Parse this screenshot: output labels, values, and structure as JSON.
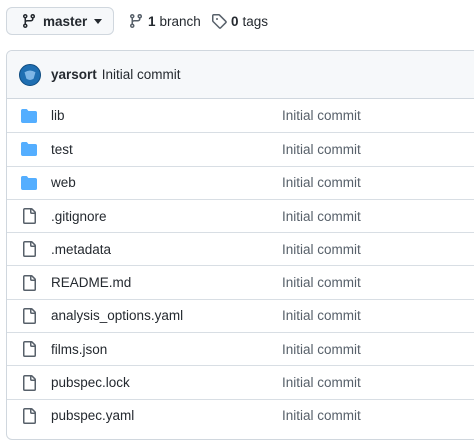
{
  "branch_selector": {
    "label": "master"
  },
  "branches": {
    "count": "1",
    "label": "branch"
  },
  "tags": {
    "count": "0",
    "label": "tags"
  },
  "latest_commit": {
    "author": "yarsort",
    "message": "Initial commit"
  },
  "files": [
    {
      "name": "lib",
      "type": "folder",
      "commit": "Initial commit"
    },
    {
      "name": "test",
      "type": "folder",
      "commit": "Initial commit"
    },
    {
      "name": "web",
      "type": "folder",
      "commit": "Initial commit"
    },
    {
      "name": ".gitignore",
      "type": "file",
      "commit": "Initial commit"
    },
    {
      "name": ".metadata",
      "type": "file",
      "commit": "Initial commit"
    },
    {
      "name": "README.md",
      "type": "file",
      "commit": "Initial commit"
    },
    {
      "name": "analysis_options.yaml",
      "type": "file",
      "commit": "Initial commit"
    },
    {
      "name": "films.json",
      "type": "file",
      "commit": "Initial commit"
    },
    {
      "name": "pubspec.lock",
      "type": "file",
      "commit": "Initial commit"
    },
    {
      "name": "pubspec.yaml",
      "type": "file",
      "commit": "Initial commit"
    }
  ],
  "colors": {
    "folder_icon": "#54aeff",
    "file_icon": "#57606a",
    "avatar": "#1f6fb2"
  }
}
